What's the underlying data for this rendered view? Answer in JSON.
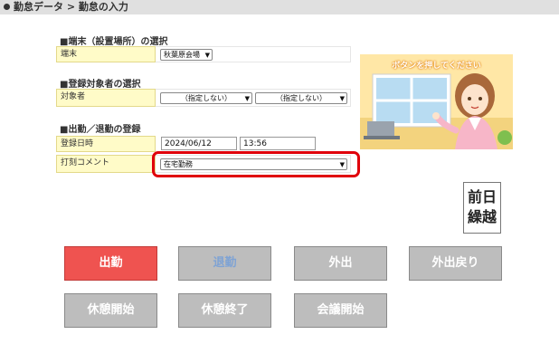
{
  "breadcrumb": "勤怠データ > 勤怠の入力",
  "sections": {
    "terminal": "■端末（設置場所）の選択",
    "target": "■登録対象者の選択",
    "attendance": "■出勤／退勤の登録"
  },
  "terminal": {
    "label": "端末",
    "value": "秋葉原会場"
  },
  "target": {
    "label": "対象者",
    "select1": "（指定しない）",
    "select2": "（指定しない）"
  },
  "registration": {
    "label": "登録日時",
    "date": "2024/06/12",
    "time": "13:56"
  },
  "comment": {
    "label": "打刻コメント",
    "value": "在宅勤務"
  },
  "illustration": {
    "caption": "ボタンを押してください"
  },
  "carryover_button": {
    "line1": "前日",
    "line2": "繰越"
  },
  "buttons": {
    "clock_in": "出勤",
    "clock_out": "退勤",
    "go_out": "外出",
    "return": "外出戻り",
    "break_start": "休憩開始",
    "break_end": "休憩終了",
    "meeting_start": "会議開始"
  },
  "colors": {
    "clock_in_bg": "#ef5350",
    "button_bg": "#bdbdbd",
    "label_bg": "#fffbc8",
    "highlight": "#e0000b"
  }
}
